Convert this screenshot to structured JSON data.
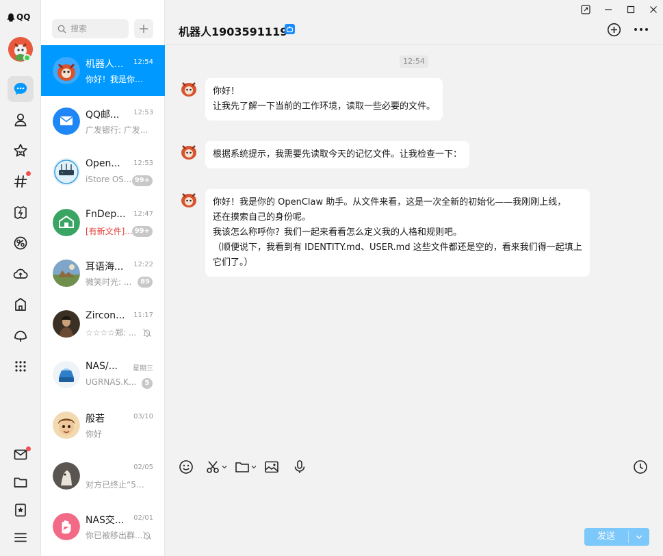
{
  "app": {
    "brand": "QQ"
  },
  "search": {
    "placeholder": "搜索"
  },
  "conversations": [
    {
      "name": "机器人...",
      "time": "12:54",
      "preview": "你好！我是你的 ...",
      "badge": "",
      "muted": false
    },
    {
      "name": "QQ邮...",
      "time": "12:53",
      "preview": "广发银行: 广发...",
      "badge": "",
      "muted": false
    },
    {
      "name": "Open...",
      "time": "12:53",
      "preview": "iStore OS...",
      "badge": "99+",
      "muted": false
    },
    {
      "name": "FnDep...",
      "time": "12:47",
      "preview": "[有新文件]...",
      "badge": "99+",
      "muted": false
    },
    {
      "name": "耳语海...",
      "time": "12:22",
      "preview": "微笑时光: ...",
      "badge": "89",
      "muted": false
    },
    {
      "name": "Zircon...",
      "time": "11:17",
      "preview": "☆☆☆☆郑: ...",
      "badge": "",
      "muted": true
    },
    {
      "name": "NAS/...",
      "time": "星期三",
      "preview": "UGRNAS.K...",
      "badge": "5",
      "muted": false
    },
    {
      "name": "般若",
      "time": "03/10",
      "preview": "你好",
      "badge": "",
      "muted": false
    },
    {
      "name": "",
      "time": "02/05",
      "preview": "对方已终止“5月...",
      "badge": "",
      "muted": false
    },
    {
      "name": "NAS交...",
      "time": "02/01",
      "preview": "你已被移出群...",
      "badge": "",
      "muted": true
    }
  ],
  "chat": {
    "title": "机器人1903591119",
    "time_separator": "12:54",
    "messages": [
      {
        "lines": [
          "你好！",
          "让我先了解一下当前的工作环境，读取一些必要的文件。"
        ]
      },
      {
        "lines": [
          "根据系统提示，我需要先读取今天的记忆文件。让我检查一下："
        ]
      },
      {
        "lines": [
          "你好！我是你的 OpenClaw 助手。从文件来看，这是一次全新的初始化——我刚刚上线，",
          "还在摸索自己的身份呢。",
          "我该怎么称呼你？我们一起来看看怎么定义我的人格和规则吧。",
          "（顺便说下，我看到有 IDENTITY.md、USER.md 这些文件都还是空的，看来我们得一起填上",
          "它们了。）"
        ]
      }
    ],
    "send_label": "发送"
  },
  "colors": {
    "accent": "#0099ff",
    "send": "#7cc8fb",
    "badge": "#c8c8c8",
    "dot": "#f34f4f"
  }
}
